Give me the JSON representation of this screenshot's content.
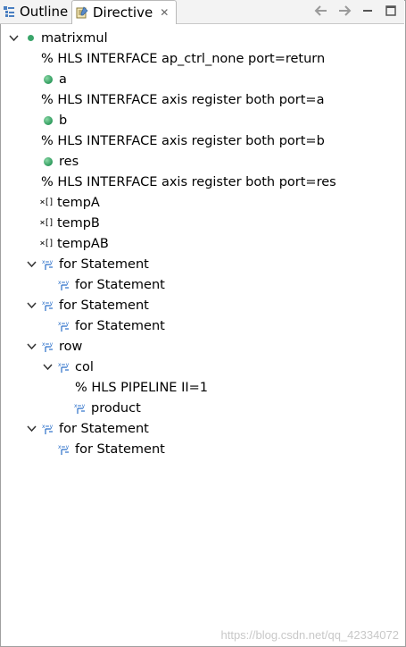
{
  "tabs": [
    {
      "label": "Outline",
      "icon": "outline-icon"
    },
    {
      "label": "Directive",
      "icon": "directive-icon",
      "close": "✕"
    }
  ],
  "toolbar": [
    "back-arrow-icon",
    "forward-arrow-icon",
    "minimize-icon",
    "maximize-icon"
  ],
  "tree": {
    "root": "matrixmul",
    "items": [
      {
        "label": "% HLS INTERFACE ap_ctrl_none port=return"
      },
      {
        "label": "a"
      },
      {
        "label": "% HLS INTERFACE axis register both port=a"
      },
      {
        "label": "b"
      },
      {
        "label": "% HLS INTERFACE axis register both port=b"
      },
      {
        "label": "res"
      },
      {
        "label": "% HLS INTERFACE axis register both port=res"
      },
      {
        "label": "tempA",
        "icon_glyph": "×[]"
      },
      {
        "label": "tempB",
        "icon_glyph": "×[]"
      },
      {
        "label": "tempAB",
        "icon_glyph": "×[]"
      },
      {
        "label": "for Statement"
      },
      {
        "label": "for Statement"
      },
      {
        "label": "for Statement"
      },
      {
        "label": "for Statement"
      },
      {
        "label": "row"
      },
      {
        "label": "col"
      },
      {
        "label": "% HLS PIPELINE II=1"
      },
      {
        "label": "product"
      },
      {
        "label": "for Statement"
      },
      {
        "label": "for Statement"
      }
    ]
  },
  "watermark": "https://blog.csdn.net/qq_42334072",
  "colors": {
    "port_dot": "#3aa56a",
    "loop_icon": "#2a6fc9"
  }
}
